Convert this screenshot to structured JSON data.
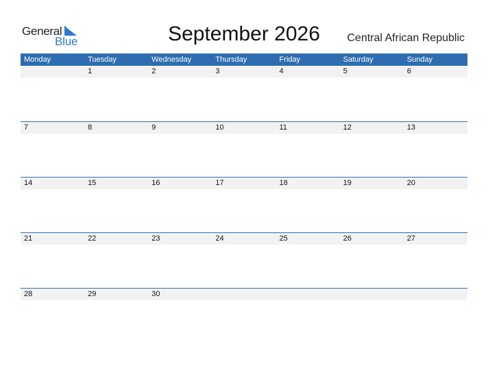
{
  "logo": {
    "line1": "General",
    "line2": "Blue",
    "accent": "#2a7bd1"
  },
  "title": "September 2026",
  "country": "Central African Republic",
  "colors": {
    "header_bg": "#2e6db0",
    "date_strip_bg": "#f2f2f2"
  },
  "weekdays": [
    "Monday",
    "Tuesday",
    "Wednesday",
    "Thursday",
    "Friday",
    "Saturday",
    "Sunday"
  ],
  "weeks": [
    [
      "",
      "1",
      "2",
      "3",
      "4",
      "5",
      "6"
    ],
    [
      "7",
      "8",
      "9",
      "10",
      "11",
      "12",
      "13"
    ],
    [
      "14",
      "15",
      "16",
      "17",
      "18",
      "19",
      "20"
    ],
    [
      "21",
      "22",
      "23",
      "24",
      "25",
      "26",
      "27"
    ],
    [
      "28",
      "29",
      "30",
      "",
      "",
      "",
      ""
    ]
  ]
}
